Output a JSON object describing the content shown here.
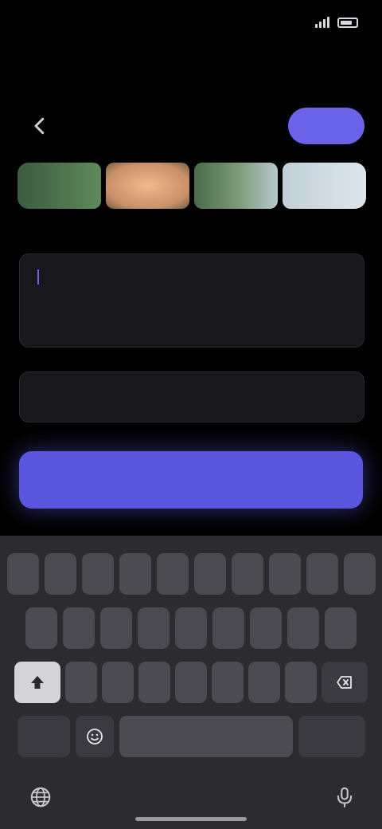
{
  "status_bar": {
    "time": "",
    "network": ""
  },
  "header": {
    "back_icon": "chevron-left-icon",
    "post_label": ""
  },
  "photos": {
    "items": [
      "photo-1",
      "photo-2",
      "photo-3",
      "photo-4"
    ]
  },
  "form": {
    "section_label": "",
    "text_value": "",
    "link_field_value": ""
  },
  "primary_button": {
    "label": ""
  },
  "keyboard": {
    "row1": [
      "",
      "",
      "",
      "",
      "",
      "",
      "",
      "",
      "",
      ""
    ],
    "row2": [
      "",
      "",
      "",
      "",
      "",
      "",
      "",
      "",
      ""
    ],
    "row3": [
      "",
      "",
      "",
      "",
      "",
      "",
      ""
    ],
    "space_label": "",
    "return_label": "",
    "icons": [
      "shift-icon",
      "delete-icon",
      "emoji-icon",
      "globe-icon",
      "mic-icon"
    ]
  },
  "colors": {
    "accent": "#5a55dd",
    "background": "#000000",
    "keyboard": "#2b2b30"
  }
}
